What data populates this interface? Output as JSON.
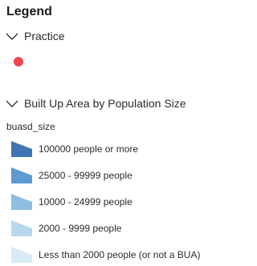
{
  "legend": {
    "title": "Legend"
  },
  "layers": [
    {
      "label": "Practice",
      "symbol_color": "#f0444e"
    },
    {
      "label": "Built Up Area by Population Size",
      "field": "buasd_size",
      "classes": [
        {
          "label": "100000 people or more",
          "color": "#3f75b3"
        },
        {
          "label": "25000 - 99999 people",
          "color": "#5f9bd1"
        },
        {
          "label": "10000 - 24999 people",
          "color": "#8dbfe3"
        },
        {
          "label": "2000 - 9999 people",
          "color": "#b6d8ee"
        },
        {
          "label": "Less than 2000 people (or not a BUA)",
          "color": "#d8eaf6"
        }
      ]
    }
  ]
}
